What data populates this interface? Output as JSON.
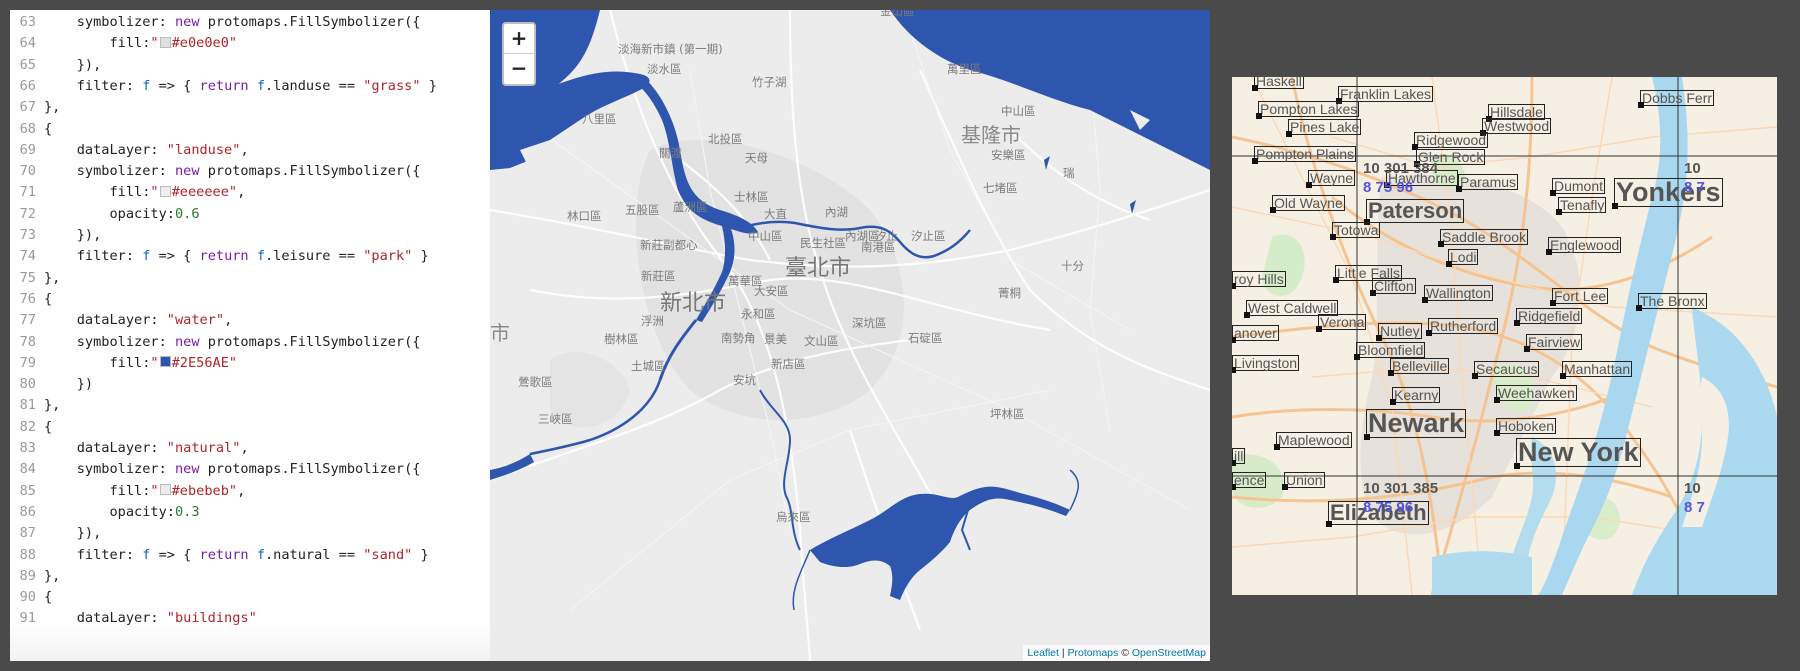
{
  "editor": {
    "lines": [
      {
        "n": "63",
        "tokens": [
          {
            "t": "    symbolizer: ",
            "c": "op"
          },
          {
            "t": "new",
            "c": "kw"
          },
          {
            "t": " protomaps.FillSymbolizer({",
            "c": "op"
          }
        ]
      },
      {
        "n": "64",
        "tokens": [
          {
            "t": "        fill:",
            "c": "op"
          },
          {
            "t": "\"",
            "c": "str"
          },
          {
            "swatch": "#e0e0e0"
          },
          {
            "t": "#e0e0e0\"",
            "c": "str"
          }
        ]
      },
      {
        "n": "65",
        "tokens": [
          {
            "t": "    }),",
            "c": "op"
          }
        ]
      },
      {
        "n": "66",
        "tokens": [
          {
            "t": "    filter: ",
            "c": "op"
          },
          {
            "t": "f",
            "c": "var"
          },
          {
            "t": " => { ",
            "c": "op"
          },
          {
            "t": "return",
            "c": "kw"
          },
          {
            "t": " ",
            "c": "op"
          },
          {
            "t": "f",
            "c": "var"
          },
          {
            "t": ".landuse == ",
            "c": "op"
          },
          {
            "t": "\"grass\"",
            "c": "str"
          },
          {
            "t": " }",
            "c": "op"
          }
        ]
      },
      {
        "n": "67",
        "tokens": [
          {
            "t": "},",
            "c": "op"
          }
        ]
      },
      {
        "n": "68",
        "tokens": [
          {
            "t": "{",
            "c": "op"
          }
        ]
      },
      {
        "n": "69",
        "tokens": [
          {
            "t": "    dataLayer: ",
            "c": "op"
          },
          {
            "t": "\"landuse\"",
            "c": "str"
          },
          {
            "t": ",",
            "c": "op"
          }
        ]
      },
      {
        "n": "70",
        "tokens": [
          {
            "t": "    symbolizer: ",
            "c": "op"
          },
          {
            "t": "new",
            "c": "kw"
          },
          {
            "t": " protomaps.FillSymbolizer({",
            "c": "op"
          }
        ]
      },
      {
        "n": "71",
        "tokens": [
          {
            "t": "        fill:",
            "c": "op"
          },
          {
            "t": "\"",
            "c": "str"
          },
          {
            "swatch": "#eeeeee"
          },
          {
            "t": "#eeeeee\"",
            "c": "str"
          },
          {
            "t": ",",
            "c": "op"
          }
        ]
      },
      {
        "n": "72",
        "tokens": [
          {
            "t": "        opacity:",
            "c": "op"
          },
          {
            "t": "0.6",
            "c": "num"
          }
        ]
      },
      {
        "n": "73",
        "tokens": [
          {
            "t": "    }),",
            "c": "op"
          }
        ]
      },
      {
        "n": "74",
        "tokens": [
          {
            "t": "    filter: ",
            "c": "op"
          },
          {
            "t": "f",
            "c": "var"
          },
          {
            "t": " => { ",
            "c": "op"
          },
          {
            "t": "return",
            "c": "kw"
          },
          {
            "t": " ",
            "c": "op"
          },
          {
            "t": "f",
            "c": "var"
          },
          {
            "t": ".leisure == ",
            "c": "op"
          },
          {
            "t": "\"park\"",
            "c": "str"
          },
          {
            "t": " }",
            "c": "op"
          }
        ]
      },
      {
        "n": "75",
        "tokens": [
          {
            "t": "},",
            "c": "op"
          }
        ]
      },
      {
        "n": "76",
        "tokens": [
          {
            "t": "{",
            "c": "op"
          }
        ]
      },
      {
        "n": "77",
        "tokens": [
          {
            "t": "    dataLayer: ",
            "c": "op"
          },
          {
            "t": "\"water\"",
            "c": "str"
          },
          {
            "t": ",",
            "c": "op"
          }
        ]
      },
      {
        "n": "78",
        "tokens": [
          {
            "t": "    symbolizer: ",
            "c": "op"
          },
          {
            "t": "new",
            "c": "kw"
          },
          {
            "t": " protomaps.FillSymbolizer({",
            "c": "op"
          }
        ]
      },
      {
        "n": "79",
        "tokens": [
          {
            "t": "        fill:",
            "c": "op"
          },
          {
            "t": "\"",
            "c": "str"
          },
          {
            "swatch": "#2E56AE"
          },
          {
            "t": "#2E56AE\"",
            "c": "str"
          }
        ]
      },
      {
        "n": "80",
        "tokens": [
          {
            "t": "    })",
            "c": "op"
          }
        ]
      },
      {
        "n": "81",
        "tokens": [
          {
            "t": "},",
            "c": "op"
          }
        ]
      },
      {
        "n": "82",
        "tokens": [
          {
            "t": "{",
            "c": "op"
          }
        ]
      },
      {
        "n": "83",
        "tokens": [
          {
            "t": "    dataLayer: ",
            "c": "op"
          },
          {
            "t": "\"natural\"",
            "c": "str"
          },
          {
            "t": ",",
            "c": "op"
          }
        ]
      },
      {
        "n": "84",
        "tokens": [
          {
            "t": "    symbolizer: ",
            "c": "op"
          },
          {
            "t": "new",
            "c": "kw"
          },
          {
            "t": " protomaps.FillSymbolizer({",
            "c": "op"
          }
        ]
      },
      {
        "n": "85",
        "tokens": [
          {
            "t": "        fill:",
            "c": "op"
          },
          {
            "t": "\"",
            "c": "str"
          },
          {
            "swatch": "#ebebeb"
          },
          {
            "t": "#ebebeb\"",
            "c": "str"
          },
          {
            "t": ",",
            "c": "op"
          }
        ]
      },
      {
        "n": "86",
        "tokens": [
          {
            "t": "        opacity:",
            "c": "op"
          },
          {
            "t": "0.3",
            "c": "num"
          }
        ]
      },
      {
        "n": "87",
        "tokens": [
          {
            "t": "    }),",
            "c": "op"
          }
        ]
      },
      {
        "n": "88",
        "tokens": [
          {
            "t": "    filter: ",
            "c": "op"
          },
          {
            "t": "f",
            "c": "var"
          },
          {
            "t": " => { ",
            "c": "op"
          },
          {
            "t": "return",
            "c": "kw"
          },
          {
            "t": " ",
            "c": "op"
          },
          {
            "t": "f",
            "c": "var"
          },
          {
            "t": ".natural == ",
            "c": "op"
          },
          {
            "t": "\"sand\"",
            "c": "str"
          },
          {
            "t": " }",
            "c": "op"
          }
        ]
      },
      {
        "n": "89",
        "tokens": [
          {
            "t": "},",
            "c": "op"
          }
        ]
      },
      {
        "n": "90",
        "tokens": [
          {
            "t": "{",
            "c": "op"
          }
        ]
      },
      {
        "n": "91",
        "tokens": [
          {
            "t": "    dataLayer: ",
            "c": "op"
          },
          {
            "t": "\"buildings\"",
            "c": "str"
          }
        ]
      }
    ]
  },
  "map_taipei": {
    "water_color": "#2E56AE",
    "zoom_in_label": "+",
    "zoom_out_label": "−",
    "attribution": {
      "leaflet": "Leaflet",
      "sep1": " | ",
      "protomaps": "Protomaps",
      "sep2": " © ",
      "osm": "OpenStreetMap"
    },
    "labels": [
      {
        "text": "金山區",
        "cls": ""
      },
      {
        "text": "淡海新市鎮 (第一期)",
        "cls": ""
      },
      {
        "text": "淡水區",
        "cls": ""
      },
      {
        "text": "竹子湖",
        "cls": ""
      },
      {
        "text": "萬里區",
        "cls": ""
      },
      {
        "text": "八里區",
        "cls": ""
      },
      {
        "text": "北投區",
        "cls": ""
      },
      {
        "text": "中山區",
        "cls": ""
      },
      {
        "text": "基隆市",
        "cls": "city-sm"
      },
      {
        "text": "關渡",
        "cls": ""
      },
      {
        "text": "天母",
        "cls": ""
      },
      {
        "text": "安樂區",
        "cls": ""
      },
      {
        "text": "士林區",
        "cls": ""
      },
      {
        "text": "七堵區",
        "cls": ""
      },
      {
        "text": "瑞",
        "cls": ""
      },
      {
        "text": "五股區",
        "cls": ""
      },
      {
        "text": "蘆洲區",
        "cls": ""
      },
      {
        "text": "大直",
        "cls": ""
      },
      {
        "text": "內湖",
        "cls": ""
      },
      {
        "text": "林口區",
        "cls": ""
      },
      {
        "text": "中山區",
        "cls": ""
      },
      {
        "text": "內湖區",
        "cls": ""
      },
      {
        "text": "汐止",
        "cls": ""
      },
      {
        "text": "汐止區",
        "cls": ""
      },
      {
        "text": "民生社區",
        "cls": ""
      },
      {
        "text": "南港區",
        "cls": ""
      },
      {
        "text": "新莊副都心",
        "cls": ""
      },
      {
        "text": "臺北市",
        "cls": "city"
      },
      {
        "text": "新莊區",
        "cls": ""
      },
      {
        "text": "萬華區",
        "cls": ""
      },
      {
        "text": "十分",
        "cls": ""
      },
      {
        "text": "大安區",
        "cls": ""
      },
      {
        "text": "新北市",
        "cls": "city"
      },
      {
        "text": "菁桐",
        "cls": ""
      },
      {
        "text": "浮洲",
        "cls": ""
      },
      {
        "text": "永和區",
        "cls": ""
      },
      {
        "text": "深坑區",
        "cls": ""
      },
      {
        "text": "市",
        "cls": "city-sm"
      },
      {
        "text": "樹林區",
        "cls": ""
      },
      {
        "text": "南勢角",
        "cls": ""
      },
      {
        "text": "景美",
        "cls": ""
      },
      {
        "text": "文山區",
        "cls": ""
      },
      {
        "text": "石碇區",
        "cls": ""
      },
      {
        "text": "土城區",
        "cls": ""
      },
      {
        "text": "新店區",
        "cls": ""
      },
      {
        "text": "鶯歌區",
        "cls": ""
      },
      {
        "text": "安坑",
        "cls": ""
      },
      {
        "text": "三峽區",
        "cls": ""
      },
      {
        "text": "坪林區",
        "cls": ""
      },
      {
        "text": "烏來區",
        "cls": ""
      }
    ]
  },
  "map_nyc": {
    "labels": [
      {
        "text": "Haskell",
        "size": "s"
      },
      {
        "text": "Franklin Lakes",
        "size": "s"
      },
      {
        "text": "Pompton Lakes",
        "size": "s"
      },
      {
        "text": "Hillsdale",
        "size": "s"
      },
      {
        "text": "Dobbs Ferr",
        "size": "s"
      },
      {
        "text": "Pines Lake",
        "size": "s"
      },
      {
        "text": "Westwood",
        "size": "s"
      },
      {
        "text": "Ridgewood",
        "size": "s"
      },
      {
        "text": "Pompton Plains",
        "size": "s"
      },
      {
        "text": "Glen Rock",
        "size": "s"
      },
      {
        "text": "Wayne",
        "size": "s"
      },
      {
        "text": "Hawthorne",
        "size": "s"
      },
      {
        "text": "Paramus",
        "size": "s"
      },
      {
        "text": "Dumont",
        "size": "s"
      },
      {
        "text": "Yonkers",
        "size": "l"
      },
      {
        "text": "Old Wayne",
        "size": "s"
      },
      {
        "text": "Tenafly",
        "size": "s"
      },
      {
        "text": "Paterson",
        "size": "m"
      },
      {
        "text": "Totowa",
        "size": "s"
      },
      {
        "text": "Saddle Brook",
        "size": "s"
      },
      {
        "text": "Englewood",
        "size": "s"
      },
      {
        "text": "Lodi",
        "size": "s"
      },
      {
        "text": "roy Hills",
        "size": "s"
      },
      {
        "text": "Little Falls",
        "size": "s"
      },
      {
        "text": "Clifton",
        "size": "s"
      },
      {
        "text": "Wallington",
        "size": "s"
      },
      {
        "text": "Fort Lee",
        "size": "s"
      },
      {
        "text": "The Bronx",
        "size": "s"
      },
      {
        "text": "West Caldwell",
        "size": "s"
      },
      {
        "text": "Verona",
        "size": "s"
      },
      {
        "text": "Ridgefield",
        "size": "s"
      },
      {
        "text": "anover",
        "size": "s"
      },
      {
        "text": "Nutley",
        "size": "s"
      },
      {
        "text": "Rutherford",
        "size": "s"
      },
      {
        "text": "Fairview",
        "size": "s"
      },
      {
        "text": "Bloomfield",
        "size": "s"
      },
      {
        "text": "Livingston",
        "size": "s"
      },
      {
        "text": "Belleville",
        "size": "s"
      },
      {
        "text": "Secaucus",
        "size": "s"
      },
      {
        "text": "Manhattan",
        "size": "s"
      },
      {
        "text": "Kearny",
        "size": "s"
      },
      {
        "text": "Weehawken",
        "size": "s"
      },
      {
        "text": "Newark",
        "size": "l"
      },
      {
        "text": "Hoboken",
        "size": "s"
      },
      {
        "text": "Maplewood",
        "size": "s"
      },
      {
        "text": "New York",
        "size": "l"
      },
      {
        "text": "ill",
        "size": "s"
      },
      {
        "text": "ence",
        "size": "s"
      },
      {
        "text": "Union",
        "size": "s"
      },
      {
        "text": "Elizabeth",
        "size": "m"
      }
    ],
    "tile_coords": [
      {
        "a": "10 301 384",
        "b": "8 75 96"
      },
      {
        "a": "10",
        "b": "8 7"
      },
      {
        "a": "10 301 385",
        "b": "8 75 96"
      },
      {
        "a": "10",
        "b": "8 7"
      }
    ]
  }
}
